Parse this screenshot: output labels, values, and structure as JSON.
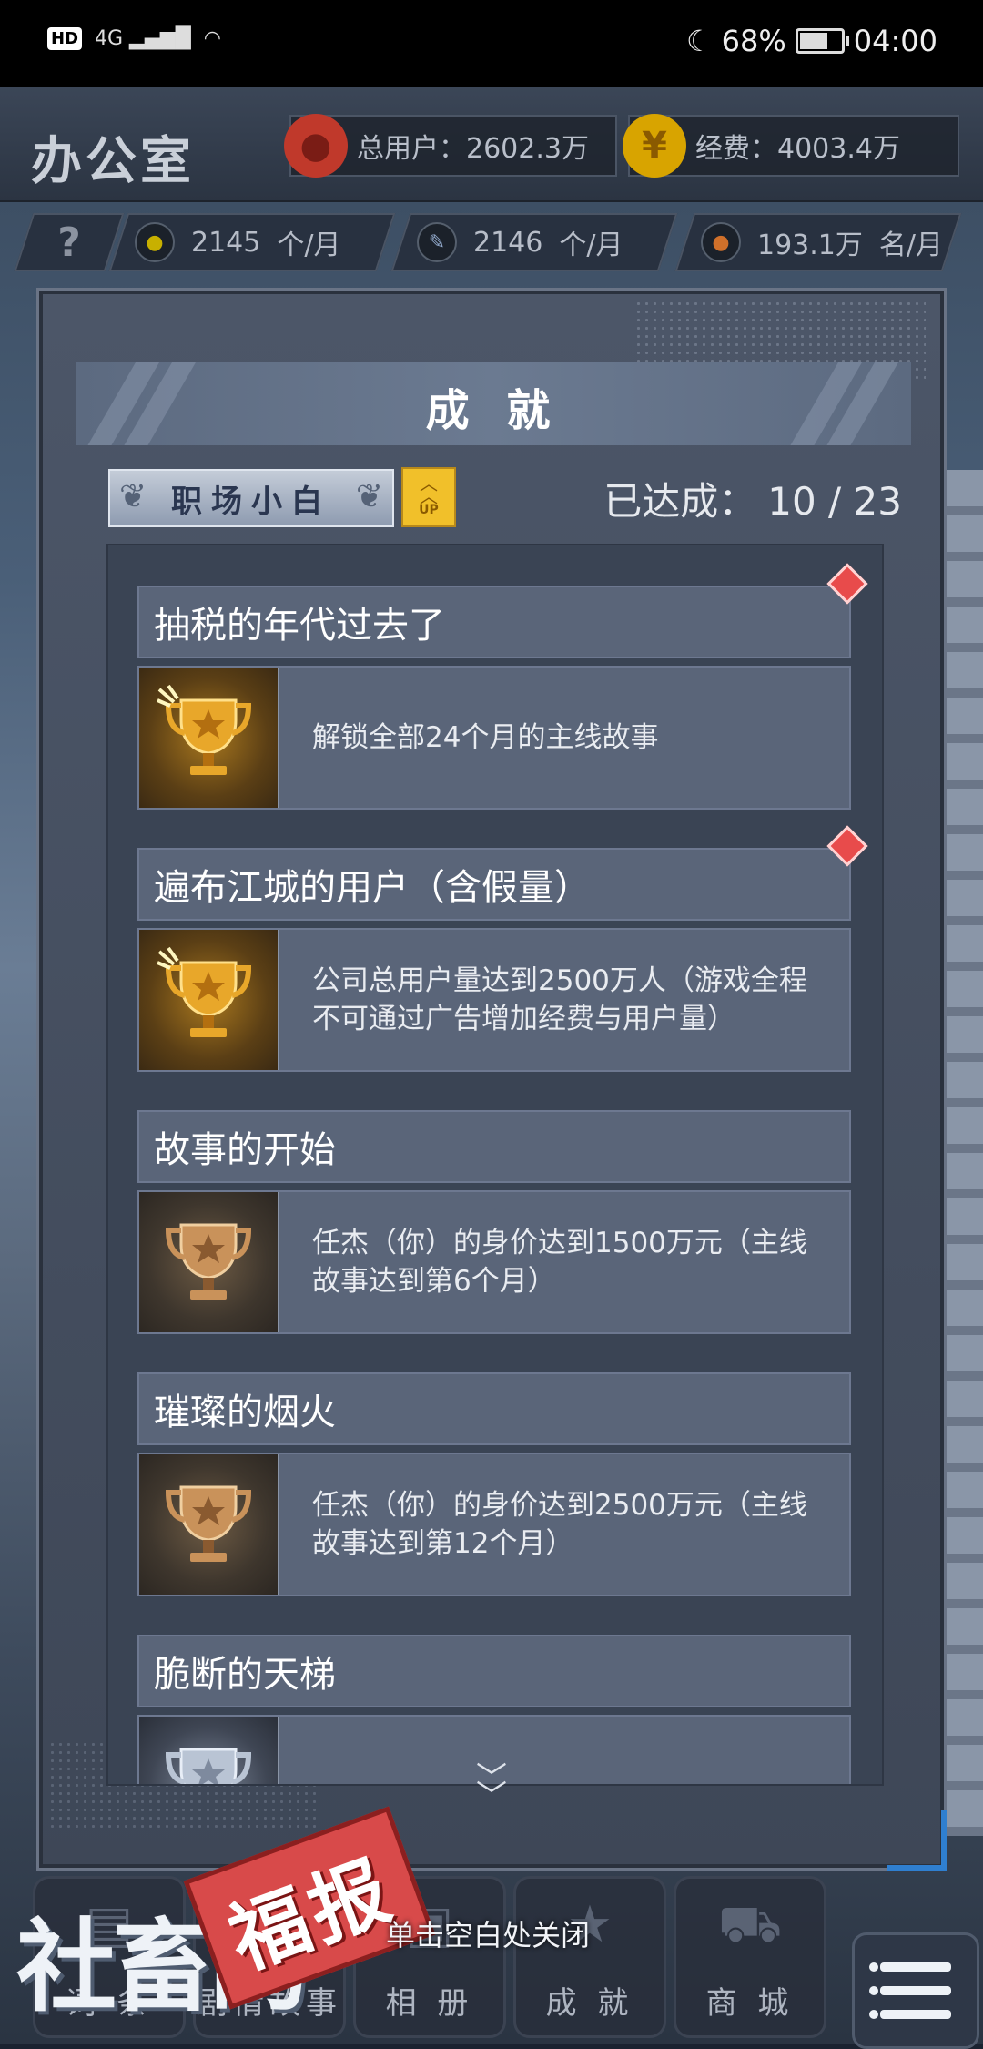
{
  "status_bar": {
    "hd": "HD",
    "network": "4G",
    "battery": "68%",
    "battery_level": 0.68,
    "time": "04:00"
  },
  "topbar": {
    "title": "办公室",
    "users_label": "总用户：2602.3万",
    "funds_label": "经费：4003.4万",
    "funds_icon_text": "¥"
  },
  "resources": {
    "help": "?",
    "ideas_value": "2145",
    "ideas_unit": "个/月",
    "tech_value": "2146",
    "tech_unit": "个/月",
    "staff_value": "193.1万",
    "staff_unit": "名/月"
  },
  "modal": {
    "title": "成 就",
    "rank": "职场小白",
    "up_label": "UP",
    "achieved_label": "已达成：",
    "achieved_count": "10 / 23"
  },
  "achievements": [
    {
      "title": "抽税的年代过去了",
      "desc": "解锁全部24个月的主线故事",
      "trophy": "gold",
      "new": true
    },
    {
      "title": "遍布江城的用户（含假量）",
      "desc": "公司总用户量达到2500万人（游戏全程不可通过广告增加经费与用户量）",
      "trophy": "gold",
      "new": true
    },
    {
      "title": "故事的开始",
      "desc": "任杰（你）的身价达到1500万元（主线故事达到第6个月）",
      "trophy": "dim",
      "new": false
    },
    {
      "title": "璀璨的烟火",
      "desc": "任杰（你）的身价达到2500万元（主线故事达到第12个月）",
      "trophy": "dim",
      "new": false
    },
    {
      "title": "脆断的天梯",
      "desc": "",
      "trophy": "silver",
      "new": false
    }
  ],
  "bottom_nav": {
    "items": [
      "词 条",
      "剧情故事",
      "相 册",
      "成 就",
      "商 城"
    ]
  },
  "logo": {
    "main": "社畜的",
    "stamp": "福报"
  },
  "close_hint": "单击空白处关闭",
  "colors": {
    "accent_red": "#e84b4b",
    "gold": "#f1c02a",
    "panel": "#5a6579"
  }
}
